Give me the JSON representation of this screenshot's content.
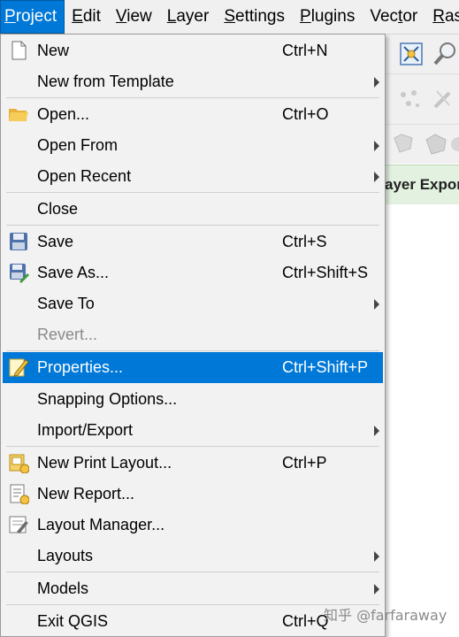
{
  "menubar": {
    "items": [
      "Project",
      "Edit",
      "View",
      "Layer",
      "Settings",
      "Plugins",
      "Vector",
      "Rast"
    ],
    "active": "Project"
  },
  "background": {
    "panel_text": "ayer Expor"
  },
  "menu": {
    "new": {
      "label": "New",
      "shortcut": "Ctrl+N"
    },
    "new_from_template": {
      "label": "New from Template"
    },
    "open": {
      "label": "Open...",
      "shortcut": "Ctrl+O"
    },
    "open_from": {
      "label": "Open From"
    },
    "open_recent": {
      "label": "Open Recent"
    },
    "close": {
      "label": "Close"
    },
    "save": {
      "label": "Save",
      "shortcut": "Ctrl+S"
    },
    "save_as": {
      "label": "Save As...",
      "shortcut": "Ctrl+Shift+S"
    },
    "save_to": {
      "label": "Save To"
    },
    "revert": {
      "label": "Revert..."
    },
    "properties": {
      "label": "Properties...",
      "shortcut": "Ctrl+Shift+P"
    },
    "snapping": {
      "label": "Snapping Options..."
    },
    "import_export": {
      "label": "Import/Export"
    },
    "new_print_layout": {
      "label": "New Print Layout...",
      "shortcut": "Ctrl+P"
    },
    "new_report": {
      "label": "New Report..."
    },
    "layout_manager": {
      "label": "Layout Manager..."
    },
    "layouts": {
      "label": "Layouts"
    },
    "models": {
      "label": "Models"
    },
    "exit": {
      "label": "Exit QGIS",
      "shortcut": "Ctrl+Q"
    }
  },
  "watermark": "知乎 @farfaraway",
  "colors": {
    "highlight": "#0078d7",
    "menu_bg": "#f2f2f2"
  }
}
